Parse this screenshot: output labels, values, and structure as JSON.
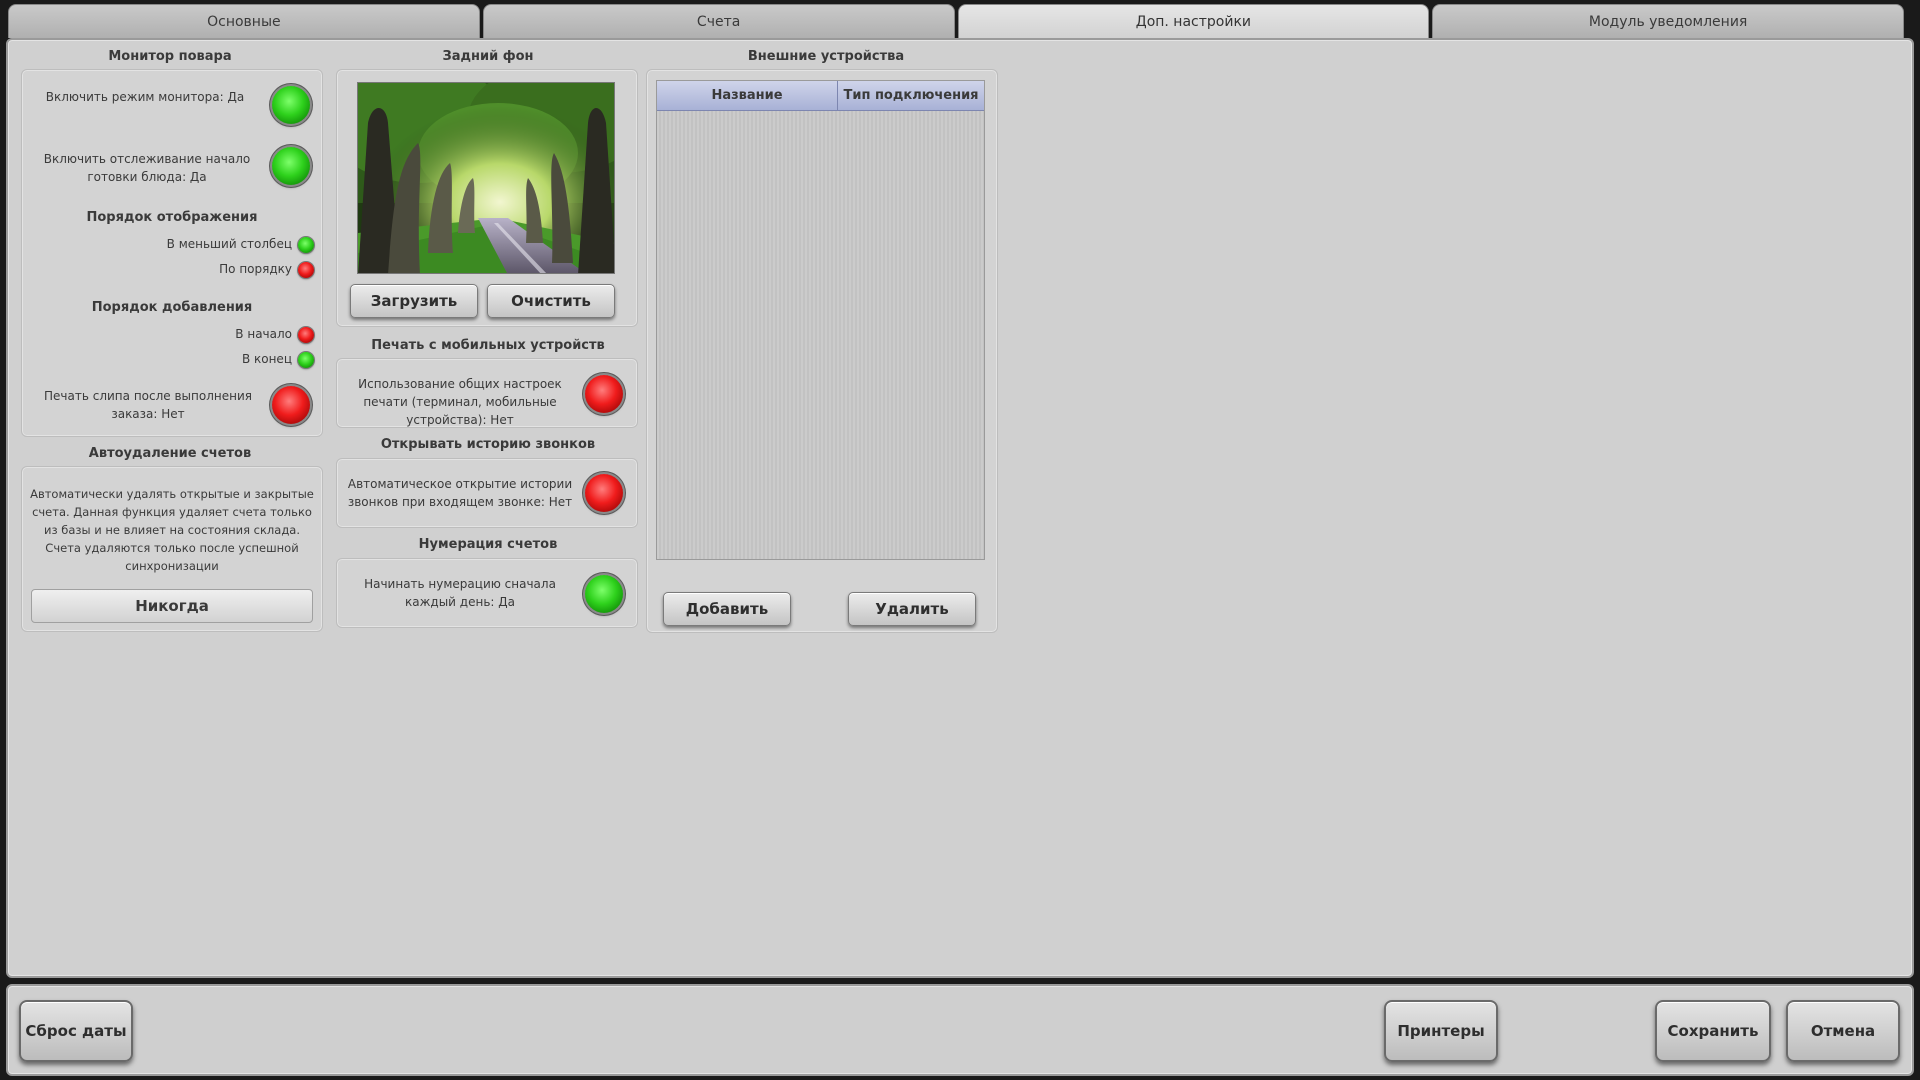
{
  "tabs": [
    {
      "label": "Основные",
      "active": false
    },
    {
      "label": "Счета",
      "active": false
    },
    {
      "label": "Доп. настройки",
      "active": true
    },
    {
      "label": "Модуль уведомления",
      "active": false
    }
  ],
  "chef_monitor": {
    "title": "Монитор повара",
    "monitor_mode_label": "Включить режим монитора: Да",
    "monitor_mode_state": "green",
    "tracking_label": "Включить отслеживание начало готовки блюда: Да",
    "tracking_state": "green",
    "display_order_title": "Порядок отображения",
    "display_order_options": [
      {
        "label": "В меньший столбец",
        "state": "green"
      },
      {
        "label": "По порядку",
        "state": "red"
      }
    ],
    "add_order_title": "Порядок добавления",
    "add_order_options": [
      {
        "label": "В начало",
        "state": "red"
      },
      {
        "label": "В конец",
        "state": "green"
      }
    ],
    "print_slip_label": "Печать слипа после выполнения заказа: Нет",
    "print_slip_state": "red"
  },
  "auto_delete": {
    "title": "Автоудаление счетов",
    "description": "Автоматически удалять открытые и закрытые счета. Данная функция удаляет счета только из базы и не влияет на состояния склада. Счета удаляются только после успешной синхронизации",
    "value": "Никогда"
  },
  "background": {
    "title": "Задний фон",
    "load_label": "Загрузить",
    "clear_label": "Очистить"
  },
  "mobile_print": {
    "title": "Печать с мобильных устройств",
    "label": "Использование общих настроек печати (терминал, мобильные устройства): Нет",
    "state": "red"
  },
  "call_history": {
    "title": "Открывать историю звонков",
    "label": "Автоматическое открытие истории звонков при входящем звонке: Нет",
    "state": "red"
  },
  "numbering": {
    "title": "Нумерация счетов",
    "label": "Начинать нумерацию сначала каждый день: Да",
    "state": "green"
  },
  "external_devices": {
    "title": "Внешние устройства",
    "columns": [
      "Название",
      "Тип подключения"
    ],
    "rows": [],
    "add_label": "Добавить",
    "delete_label": "Удалить"
  },
  "footer": {
    "reset_date_label": "Сброс даты",
    "printers_label": "Принтеры",
    "save_label": "Сохранить",
    "cancel_label": "Отмена"
  },
  "colors": {
    "led_green": "#2ed11c",
    "led_red": "#f01c1c",
    "table_header": "#a8b1d6"
  }
}
